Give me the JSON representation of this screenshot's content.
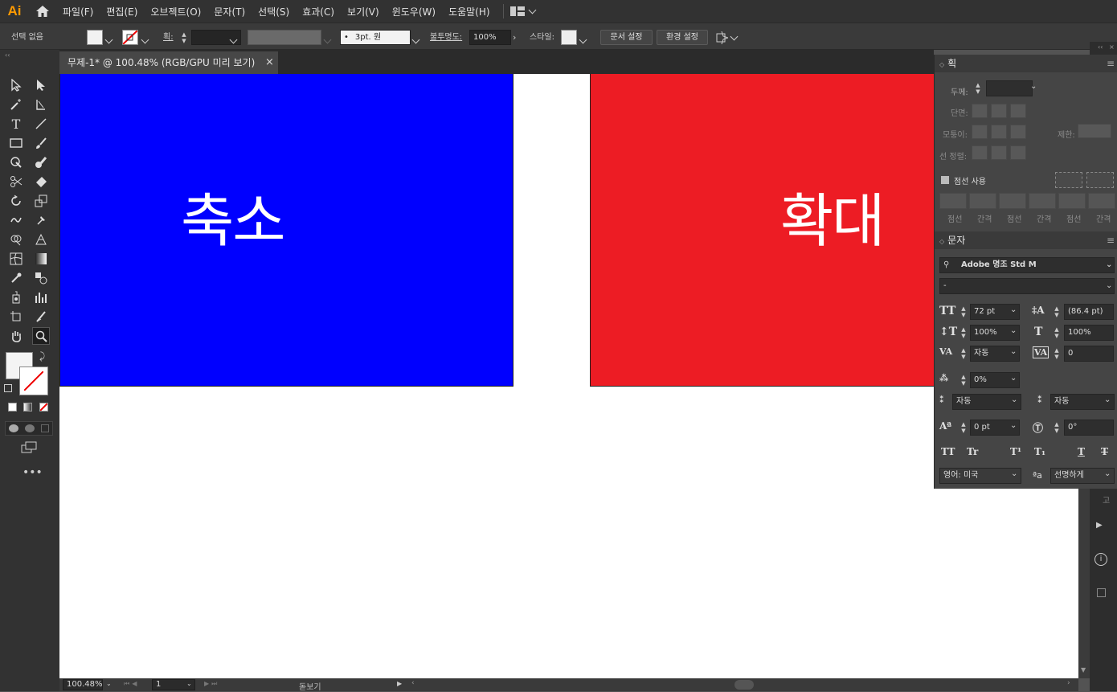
{
  "app": {
    "logo": "Ai"
  },
  "menu": [
    "파일(F)",
    "편집(E)",
    "오브젝트(O)",
    "문자(T)",
    "선택(S)",
    "효과(C)",
    "보기(V)",
    "윈도우(W)",
    "도움말(H)"
  ],
  "control": {
    "selection": "선택 없음",
    "stroke_label": "획:",
    "brush": "3pt. 원",
    "opacity_label": "불투명도:",
    "opacity": "100%",
    "style_label": "스타일:",
    "doc_setup": "문서 설정",
    "prefs": "환경 설정"
  },
  "document": {
    "tab_title": "무제-1* @ 100.48% (RGB/GPU 미리 보기)"
  },
  "artboard": {
    "left_text": "축소",
    "right_text": "확대",
    "left_color": "#0000ff",
    "right_color": "#ed1c24"
  },
  "stroke_panel": {
    "title": "획",
    "weight_label": "두께:",
    "cap_label": "단면:",
    "corner_label": "모퉁이:",
    "limit_label": "제한:",
    "align_label": "선 정렬:",
    "dashed_label": "점선 사용",
    "dash_labels": [
      "점선",
      "간격",
      "점선",
      "간격",
      "점선",
      "간격"
    ]
  },
  "char_panel": {
    "title": "문자",
    "font": "Adobe 명조 Std M",
    "style": "-",
    "size": "72 pt",
    "leading": "(86.4 pt)",
    "vscale": "100%",
    "hscale": "100%",
    "kerning": "자동",
    "tracking": "0",
    "tsume": "0%",
    "aki_left": "자동",
    "aki_right": "자동",
    "baseline": "0 pt",
    "rotation": "0°",
    "language": "영어: 미국",
    "antialias": "선명하게"
  },
  "status": {
    "zoom": "100.48%",
    "artboard": "1",
    "tool": "돋보기"
  }
}
